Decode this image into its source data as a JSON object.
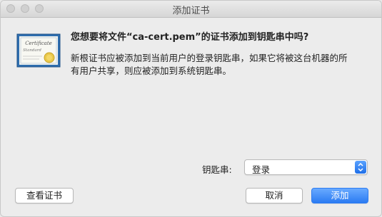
{
  "window": {
    "title": "添加证书"
  },
  "dialog": {
    "icon": "certificate-icon",
    "icon_text": {
      "line1": "Certificate",
      "line2": "Standard"
    },
    "heading": "您想要将文件“ca-cert.pem”的证书添加到钥匙串中吗?",
    "body_line1": "新根证书应被添加到当前用户的登录钥匙串，如果它将被这台机器的所",
    "body_line2": "有用户共享，则应被添加到系统钥匙串。"
  },
  "keychain": {
    "label": "钥匙串:",
    "selected": "登录"
  },
  "buttons": {
    "view": "查看证书",
    "cancel": "取消",
    "add": "添加"
  },
  "colors": {
    "accent": "#2b7bf2"
  }
}
